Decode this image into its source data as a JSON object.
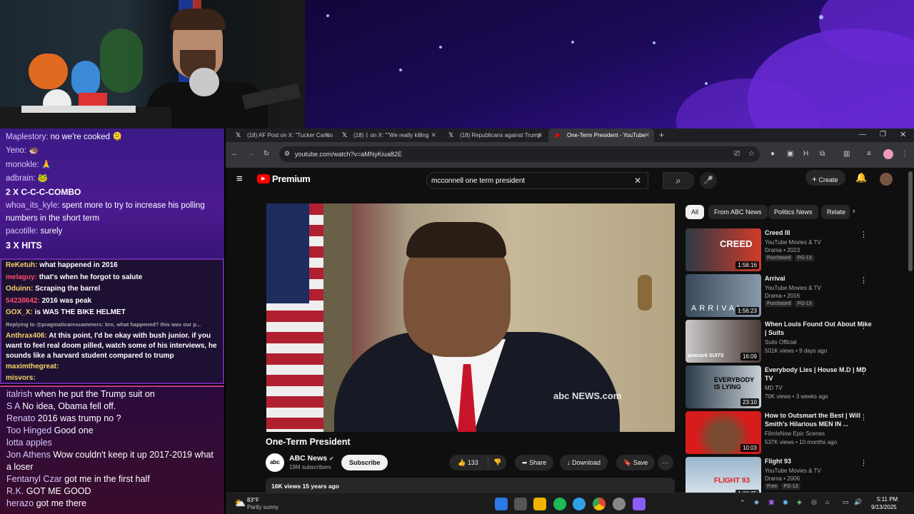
{
  "chat_top": [
    {
      "user": "Maplestory:",
      "text": "no we're cooked"
    },
    {
      "user": "Yeno:",
      "text": ""
    },
    {
      "user": "monokle:",
      "text": ""
    },
    {
      "user": "adbrain:",
      "text": ""
    },
    {
      "combo": "2 X C-C-C-COMBO"
    },
    {
      "user": "whoa_its_kyle:",
      "text": "spent more to try to increase his polling numbers in the short term"
    },
    {
      "user": "pacotille:",
      "text": "surely"
    },
    {
      "combo": "3 X HITS"
    }
  ],
  "chat_mid": [
    {
      "user": "ReKetuh:",
      "text": "what happened in 2016"
    },
    {
      "user": "melaguy:",
      "text": "that's when he forgot to salute"
    },
    {
      "user": "Oduinn:",
      "text": "Scraping the barrel"
    },
    {
      "user": "54238642:",
      "text": "2016 was peak"
    },
    {
      "user": "GOX_X:",
      "text": "is WAS THE BIKE HELMET"
    },
    {
      "user": "",
      "text": "Replying to @pragmaticarescammers: bro, what happened? this was our p..."
    },
    {
      "user": "Anthrax406:",
      "text": "At this point, I'd be okay with bush junior. if you want to feel real doom pilled, watch some of his interviews, he sounds like a harvard student compared to trump"
    },
    {
      "user": "maximthegreat:",
      "text": ""
    },
    {
      "user": "misvors:",
      "text": ""
    }
  ],
  "chat_bottom": [
    {
      "user": "italrish",
      "text": "when he put the Trump suit on"
    },
    {
      "user": "S A",
      "text": "No idea, Obama fell off."
    },
    {
      "user": "Renato",
      "text": "2016 was trump no ?"
    },
    {
      "user": "Too Hinged",
      "text": "Good one"
    },
    {
      "user": "lotta apples",
      "text": ""
    },
    {
      "user": "Jon Athens",
      "text": "Wow couldn't keep it up 2017-2019 what a loser"
    },
    {
      "user": "Fentanyl Czar",
      "text": "got me in the first half"
    },
    {
      "user": "R.K.",
      "text": "GOT ME GOOD"
    },
    {
      "user": "herazo",
      "text": "got me there"
    }
  ],
  "tabs": [
    {
      "label": "(18) AF Post on X: \"Tucker Carlso"
    },
    {
      "label": "(18) ᛒ on X: \"\"We really killing"
    },
    {
      "label": "(18) Republicans against Trump"
    },
    {
      "label": "One-Term President - YouTube"
    }
  ],
  "url": "youtube.com/watch?v=aMNyKiua82E",
  "yt": {
    "logo": "Premium",
    "search": "mcconnell one term president",
    "create": "Create",
    "title": "One-Term President",
    "channel": "ABC News",
    "subs": "19M subscribers",
    "subscribe": "Subscribe",
    "likes": "133",
    "share": "Share",
    "download": "Download",
    "save": "Save",
    "views": "16K views  15 years ago",
    "watermark": "abc NEWS.com",
    "chips": [
      "All",
      "From ABC News",
      "Politics News",
      "Relate"
    ]
  },
  "recs": [
    {
      "title": "Creed III",
      "channel": "YouTube Movies & TV",
      "meta": "Drama • 2023",
      "badges": [
        "Purchased",
        "PG-13"
      ],
      "dur": "1:56:16",
      "thumb_text": "CREED"
    },
    {
      "title": "Arrival",
      "channel": "YouTube Movies & TV",
      "meta": "Drama • 2016",
      "badges": [
        "Purchased",
        "PG-13"
      ],
      "dur": "1:56:23",
      "thumb_text": "ARRIVAL"
    },
    {
      "title": "When Louis Found Out About Mike | Suits",
      "channel": "Suits Official",
      "meta": "501K views • 9 days ago",
      "badges": [],
      "dur": "16:09",
      "thumb_text": "peacock SUITS"
    },
    {
      "title": "Everybody Lies | House M.D | MD TV",
      "channel": "MD TV",
      "meta": "70K views • 3 weeks ago",
      "badges": [],
      "dur": "23:10",
      "thumb_text": "EVERYBODY IS LYING"
    },
    {
      "title": "How to Outsmart the Best | Will Smith's Hilarious MEN IN ...",
      "channel": "FilmIsNow Epic Scenes",
      "meta": "537K views • 10 months ago",
      "badges": [],
      "dur": "10:03",
      "thumb_text": ""
    },
    {
      "title": "Flight 93",
      "channel": "YouTube Movies & TV",
      "meta": "Drama • 2006",
      "badges": [
        "Free",
        "PG-13"
      ],
      "dur": "1:30:25",
      "thumb_text": "FLIGHT 93"
    }
  ],
  "taskbar": {
    "temp": "83°F",
    "weather": "Partly sunny",
    "time": "5:11 PM",
    "date": "9/13/2025"
  }
}
